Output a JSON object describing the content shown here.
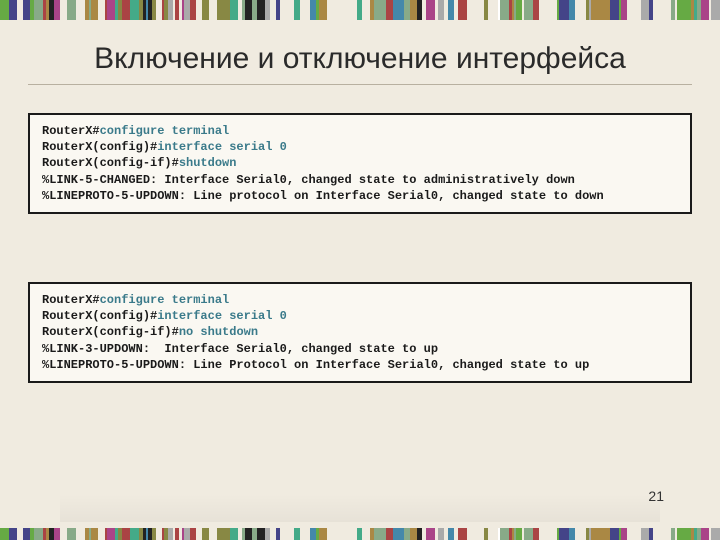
{
  "title": "Включение и отключение интерфейса",
  "page_number": "21",
  "box1": {
    "lines": [
      {
        "segments": [
          {
            "t": "RouterX#",
            "c": false
          },
          {
            "t": "configure terminal",
            "c": true
          }
        ]
      },
      {
        "segments": [
          {
            "t": "RouterX(config)#",
            "c": false
          },
          {
            "t": "interface serial 0",
            "c": true
          }
        ]
      },
      {
        "segments": [
          {
            "t": "RouterX(config-if)#",
            "c": false
          },
          {
            "t": "shutdown",
            "c": true
          }
        ]
      },
      {
        "segments": [
          {
            "t": "%LINK-5-CHANGED: Interface Serial0, changed state to administratively down",
            "c": false
          }
        ]
      },
      {
        "segments": [
          {
            "t": "%LINEPROTO-5-UPDOWN: Line protocol on Interface Serial0, changed state to down",
            "c": false
          }
        ]
      }
    ]
  },
  "box2": {
    "lines": [
      {
        "segments": [
          {
            "t": "RouterX#",
            "c": false
          },
          {
            "t": "configure terminal",
            "c": true
          }
        ]
      },
      {
        "segments": [
          {
            "t": "RouterX(config)#",
            "c": false
          },
          {
            "t": "interface serial 0",
            "c": true
          }
        ]
      },
      {
        "segments": [
          {
            "t": "RouterX(config-if)#",
            "c": false
          },
          {
            "t": "no shutdown",
            "c": true
          }
        ]
      },
      {
        "segments": [
          {
            "t": "%LINK-3-UPDOWN:  Interface Serial0, changed state to up",
            "c": false
          }
        ]
      },
      {
        "segments": [
          {
            "t": "%LINEPROTO-5-UPDOWN: Line Protocol on Interface Serial0, changed state to up",
            "c": false
          }
        ]
      }
    ]
  },
  "barcode_colors": [
    "#222",
    "#fff",
    "#8a8",
    "#a84",
    "#48a",
    "#a48",
    "#884",
    "#4a8",
    "#448",
    "#a44",
    "#aaa",
    "#6a4"
  ]
}
